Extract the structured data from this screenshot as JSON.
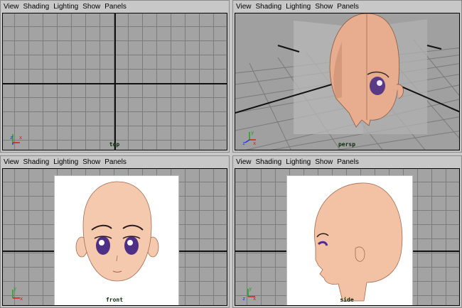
{
  "menu": [
    "View",
    "Shading",
    "Lighting",
    "Show",
    "Panels"
  ],
  "panels": {
    "top": {
      "camera": "top"
    },
    "persp": {
      "camera": "persp"
    },
    "front": {
      "camera": "front"
    },
    "side": {
      "camera": "side"
    }
  },
  "axis_gizmo": {
    "x_label": "x",
    "y_label": "y",
    "z_label": "z"
  },
  "colors": {
    "viewport_bg": "#a3a3a3",
    "grid": "#7c7c7c",
    "skin": "#f3c2a4",
    "eye": "#5b3a8a",
    "x_axis": "#d21d1d",
    "y_axis": "#1ea21e",
    "z_axis": "#1e3ad2"
  }
}
